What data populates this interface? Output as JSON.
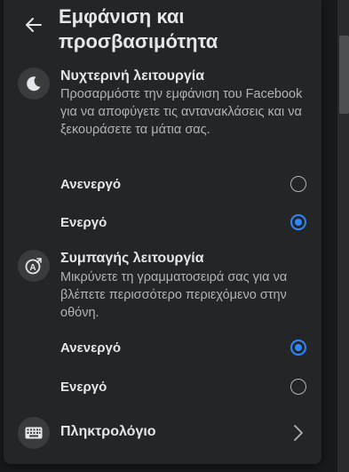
{
  "header": {
    "title": "Εμφάνιση και προσβασιμότητα",
    "back_icon": "arrow-left-icon"
  },
  "night_mode": {
    "icon": "moon-icon",
    "title": "Νυχτερινή λειτουργία",
    "description": "Προσαρμόστε την εμφάνιση του Facebook για να αποφύγετε τις αντανακλάσεις και να ξεκουράσετε τα μάτια σας.",
    "options": [
      {
        "label": "Ανενεργό",
        "selected": false
      },
      {
        "label": "Ενεργό",
        "selected": true
      }
    ]
  },
  "compact_mode": {
    "icon": "compact-text-icon",
    "title": "Συμπαγής λειτουργία",
    "description": "Μικρύνετε τη γραμματοσειρά σας για να βλέπετε περισσότερο περιεχόμενο στην οθόνη.",
    "options": [
      {
        "label": "Ανενεργό",
        "selected": true
      },
      {
        "label": "Ενεργό",
        "selected": false
      }
    ]
  },
  "keyboard": {
    "icon": "keyboard-icon",
    "label": "Πληκτρολόγιο",
    "chevron_icon": "chevron-right-icon"
  },
  "colors": {
    "accent": "#2d88ff",
    "panel": "#242526",
    "text_primary": "#e4e6eb",
    "text_secondary": "#b0b3b8"
  }
}
